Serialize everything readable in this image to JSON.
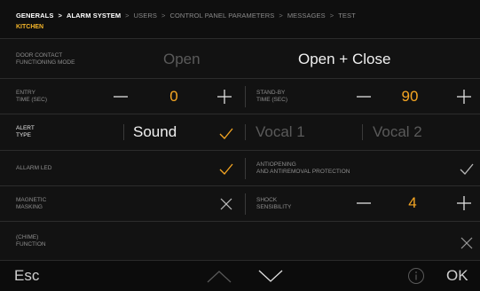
{
  "breadcrumb": {
    "items": [
      "GENERALS",
      "ALARM SYSTEM",
      "USERS",
      "CONTROL PANEL PARAMETERS",
      "MESSAGES",
      "TEST"
    ],
    "separator": ">",
    "sub": "KITCHEN"
  },
  "door_contact": {
    "label": [
      "DOOR CONTACT",
      "FUNCTIONING MODE"
    ],
    "options": [
      "Open",
      "Open + Close"
    ],
    "selected": "Open + Close"
  },
  "entry_time": {
    "label": [
      "ENTRY",
      "TIME (SEC)"
    ],
    "value": "0"
  },
  "standby_time": {
    "label": [
      "STAND-BY",
      "TIME (SEC)"
    ],
    "value": "90"
  },
  "alert_type": {
    "label": [
      "ALERT",
      "TYPE"
    ],
    "options": [
      "Sound",
      "Vocal 1",
      "Vocal 2"
    ],
    "selected": "Sound"
  },
  "alarm_led": {
    "label": "ALLARM LED",
    "state": "checked"
  },
  "antiopening": {
    "label": [
      "ANTIOPENING",
      "AND ANTIREMOVAL PROTECTION"
    ],
    "state": "checked"
  },
  "magnetic_masking": {
    "label": [
      "MAGNETIC",
      "MASKING"
    ],
    "state": "unchecked"
  },
  "shock": {
    "label": [
      "SHOCK",
      "SENSIBILITY"
    ],
    "value": "4"
  },
  "chime": {
    "label": [
      "(CHIME)",
      "FUNCTION"
    ],
    "state": "unchecked"
  },
  "footer": {
    "esc": "Esc",
    "ok": "OK",
    "up_icon": "chevron-up-icon",
    "down_icon": "chevron-down-icon",
    "info_icon": "info-icon"
  },
  "colors": {
    "accent": "#f5a623",
    "background": "#121212",
    "text": "#e6e6e6"
  }
}
